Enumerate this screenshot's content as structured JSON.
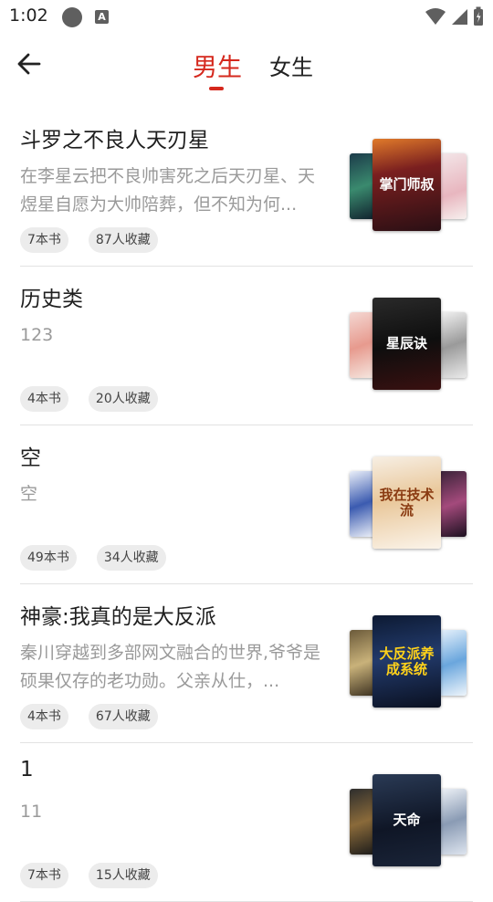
{
  "status_bar": {
    "time": "1:02"
  },
  "header": {
    "tabs": [
      {
        "label": "男生",
        "active": true
      },
      {
        "label": "女生",
        "active": false
      }
    ]
  },
  "accent_color": "#d5281d",
  "booklists": [
    {
      "title": "斗罗之不良人天刃星",
      "desc": "在李星云把不良帅害死之后天刃星、天煜星自愿为大帅陪葬，但不知为何...",
      "book_count": "7本书",
      "fav_count": "87人收藏",
      "cover_text": "掌门师叔"
    },
    {
      "title": "历史类",
      "desc": "123",
      "book_count": "4本书",
      "fav_count": "20人收藏",
      "cover_text": "星辰诀"
    },
    {
      "title": "空",
      "desc": "空",
      "book_count": "49本书",
      "fav_count": "34人收藏",
      "cover_text": "我在技术流"
    },
    {
      "title": "神豪:我真的是大反派",
      "desc": "秦川穿越到多部网文融合的世界,爷爷是硕果仅存的老功勋。父亲从仕，...",
      "book_count": "4本书",
      "fav_count": "67人收藏",
      "cover_text": "大反派养成系统"
    },
    {
      "title": "1",
      "desc": "11",
      "book_count": "7本书",
      "fav_count": "15人收藏",
      "cover_text": "天命"
    }
  ]
}
